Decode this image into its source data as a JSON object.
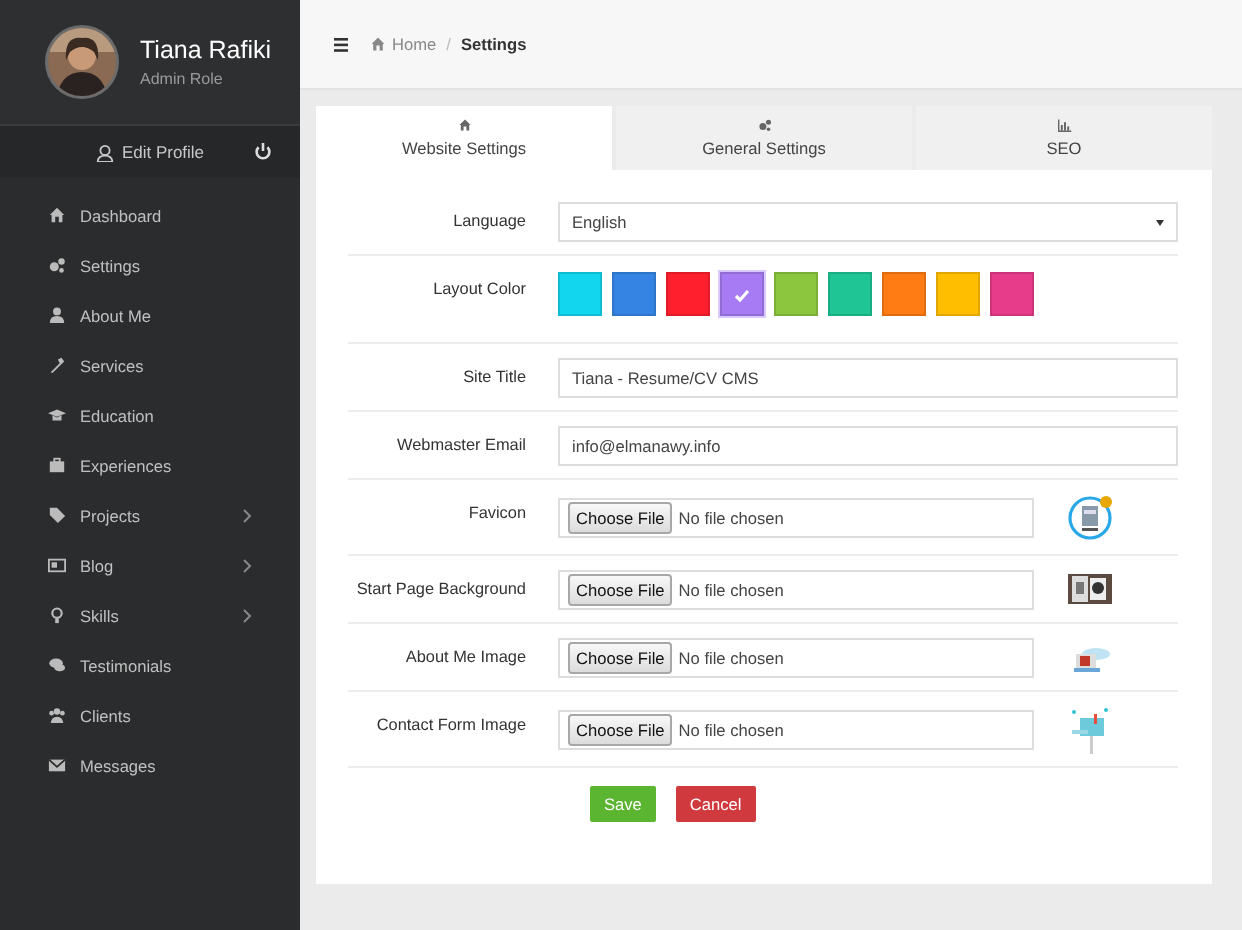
{
  "sidebar": {
    "user": {
      "name": "Tiana Rafiki",
      "role": "Admin Role"
    },
    "edit_profile": "Edit Profile",
    "items": [
      {
        "label": "Dashboard",
        "submenu": false
      },
      {
        "label": "Settings",
        "submenu": false
      },
      {
        "label": "About Me",
        "submenu": false
      },
      {
        "label": "Services",
        "submenu": false
      },
      {
        "label": "Education",
        "submenu": false
      },
      {
        "label": "Experiences",
        "submenu": false
      },
      {
        "label": "Projects",
        "submenu": true
      },
      {
        "label": "Blog",
        "submenu": true
      },
      {
        "label": "Skills",
        "submenu": true
      },
      {
        "label": "Testimonials",
        "submenu": false
      },
      {
        "label": "Clients",
        "submenu": false
      },
      {
        "label": "Messages",
        "submenu": false
      }
    ]
  },
  "breadcrumb": {
    "separator": "/",
    "items": [
      {
        "label": "Home",
        "current": false
      },
      {
        "label": "Settings",
        "current": true
      }
    ]
  },
  "tabs": [
    {
      "label": "Website Settings",
      "selected": true
    },
    {
      "label": "General Settings",
      "selected": false
    },
    {
      "label": "SEO",
      "selected": false
    }
  ],
  "form": {
    "language": {
      "label": "Language",
      "value": "English"
    },
    "layout_color": {
      "label": "Layout Color",
      "colors": [
        {
          "color": "#11d6ee",
          "selected": false
        },
        {
          "color": "#3584e4",
          "selected": false
        },
        {
          "color": "#ff1f2d",
          "selected": false
        },
        {
          "color": "#a77bf3",
          "selected": true
        },
        {
          "color": "#8cc63e",
          "selected": false
        },
        {
          "color": "#1fc594",
          "selected": false
        },
        {
          "color": "#ff7c14",
          "selected": false
        },
        {
          "color": "#ffbf00",
          "selected": false
        },
        {
          "color": "#e73c8a",
          "selected": false
        }
      ]
    },
    "site_title": {
      "label": "Site Title",
      "value": "Tiana - Resume/CV CMS"
    },
    "webmaster_email": {
      "label": "Webmaster Email",
      "value": "info@elmanawy.info"
    },
    "uploads": [
      {
        "label": "Favicon",
        "button": "Choose File",
        "status": "No file chosen"
      },
      {
        "label": "Start Page Background",
        "button": "Choose File",
        "status": "No file chosen"
      },
      {
        "label": "About Me Image",
        "button": "Choose File",
        "status": "No file chosen"
      },
      {
        "label": "Contact Form Image",
        "button": "Choose File",
        "status": "No file chosen"
      }
    ],
    "buttons": [
      {
        "label": "Save",
        "kind": "save"
      },
      {
        "label": "Cancel",
        "kind": "cancel"
      }
    ]
  }
}
